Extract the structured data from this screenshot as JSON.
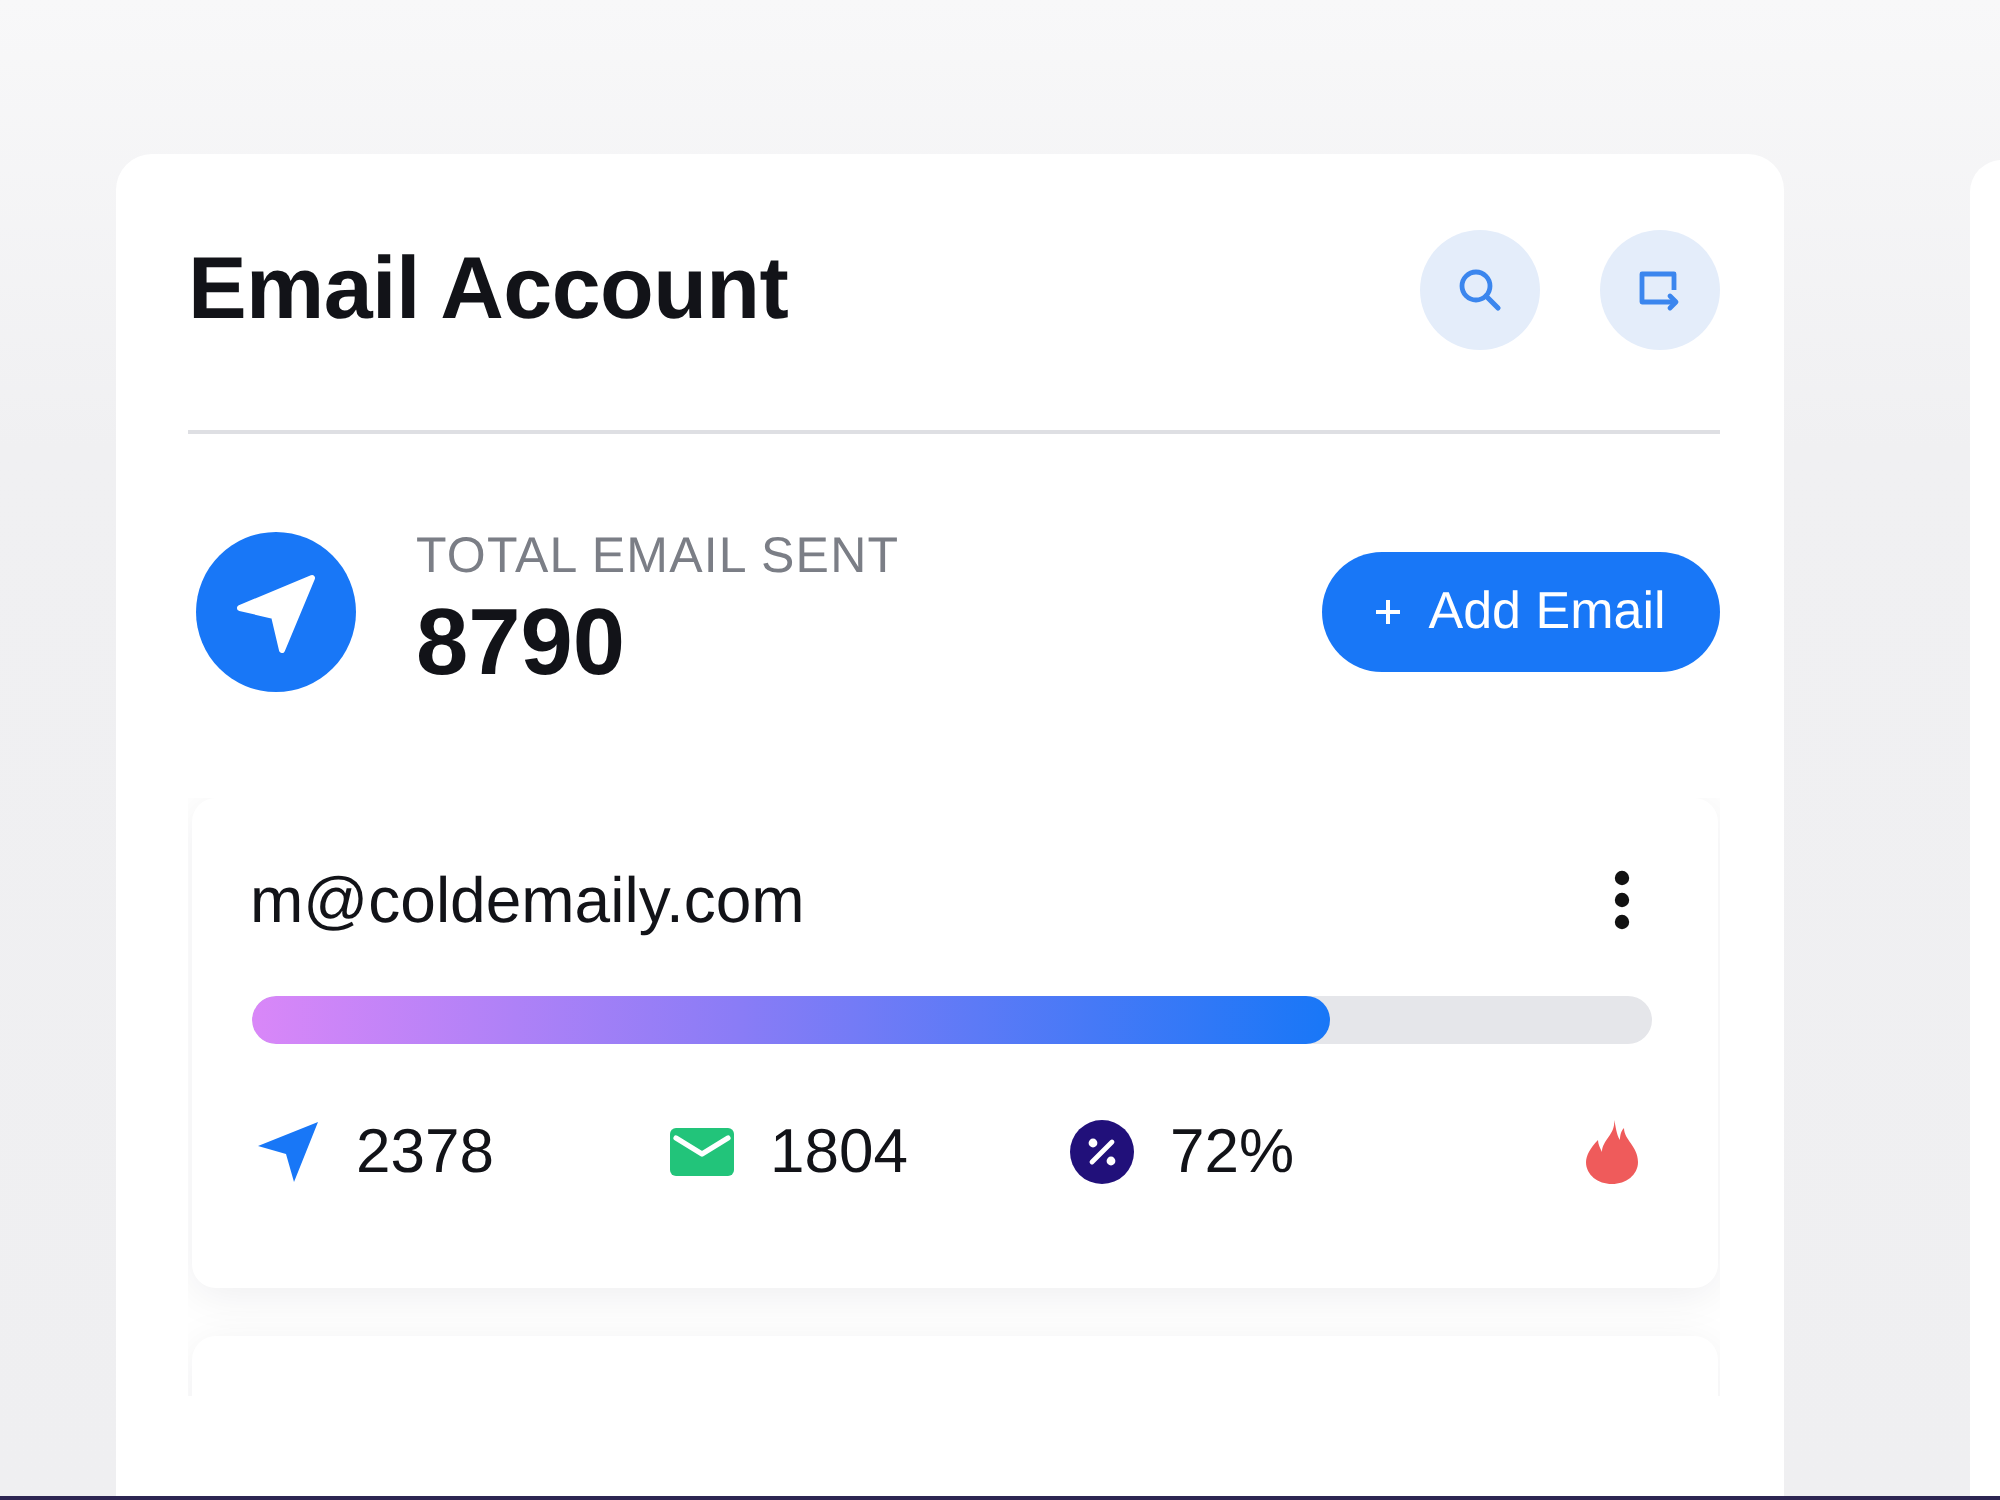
{
  "header": {
    "title": "Email Account"
  },
  "summary": {
    "label": "TOTAL EMAIL SENT",
    "value": "8790",
    "add_button": "Add Email"
  },
  "accounts": [
    {
      "email": "m@coldemaily.com",
      "level": 0.77,
      "stats": [
        {
          "kind": "sent",
          "value": "2378"
        },
        {
          "kind": "mail",
          "value": "1804"
        },
        {
          "kind": "percent",
          "value": "72%"
        }
      ],
      "hot": true
    }
  ]
}
